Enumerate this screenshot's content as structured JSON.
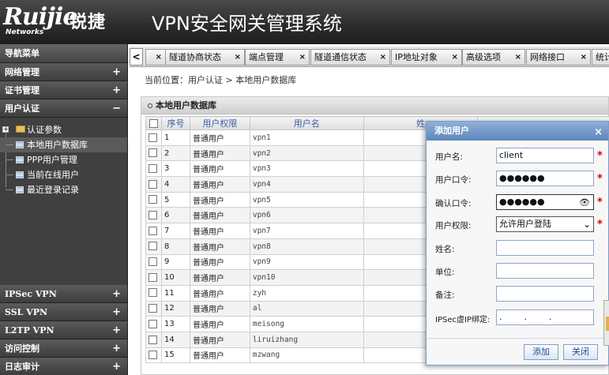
{
  "header": {
    "logo_text": "Ruijie",
    "logo_cn": "锐捷",
    "logo_sub": "Networks",
    "system_title": "VPN安全网关管理系统"
  },
  "sidebar": {
    "title": "导航菜单",
    "top_menus": [
      {
        "label": "网络管理",
        "state": "+"
      },
      {
        "label": "证书管理",
        "state": "+"
      },
      {
        "label": "用户认证",
        "state": "−"
      }
    ],
    "tree": [
      {
        "label": "认证参数"
      },
      {
        "label": "本地用户数据库"
      },
      {
        "label": "PPP用户管理"
      },
      {
        "label": "当前在线用户"
      },
      {
        "label": "最近登录记录"
      }
    ],
    "bottom_menus": [
      {
        "label": "IPSec VPN",
        "state": "+"
      },
      {
        "label": "SSL VPN",
        "state": "+"
      },
      {
        "label": "L2TP VPN",
        "state": "+"
      },
      {
        "label": "访问控制",
        "state": "+"
      },
      {
        "label": "日志审计",
        "state": "+"
      }
    ]
  },
  "tabs": {
    "prev_label": "<",
    "close_label": "×",
    "items": [
      {
        "label": ""
      },
      {
        "label": "隧道协商状态"
      },
      {
        "label": "端点管理"
      },
      {
        "label": "隧道通信状态"
      },
      {
        "label": "IP地址对象"
      },
      {
        "label": "高级选项"
      },
      {
        "label": "网络接口"
      },
      {
        "label": "统计"
      }
    ]
  },
  "breadcrumb": "当前位置：用户认证 > 本地用户数据库",
  "panel": {
    "title": "本地用户数据库",
    "columns": [
      "序号",
      "用户权限",
      "用户名",
      "姓"
    ],
    "rows": [
      {
        "no": "1",
        "perm": "普通用户",
        "name": "vpn1"
      },
      {
        "no": "2",
        "perm": "普通用户",
        "name": "vpn2"
      },
      {
        "no": "3",
        "perm": "普通用户",
        "name": "vpn3"
      },
      {
        "no": "4",
        "perm": "普通用户",
        "name": "vpn4"
      },
      {
        "no": "5",
        "perm": "普通用户",
        "name": "vpn5"
      },
      {
        "no": "6",
        "perm": "普通用户",
        "name": "vpn6"
      },
      {
        "no": "7",
        "perm": "普通用户",
        "name": "vpn7"
      },
      {
        "no": "8",
        "perm": "普通用户",
        "name": "vpn8"
      },
      {
        "no": "9",
        "perm": "普通用户",
        "name": "vpn9"
      },
      {
        "no": "10",
        "perm": "普通用户",
        "name": "vpn10"
      },
      {
        "no": "11",
        "perm": "普通用户",
        "name": "zyh"
      },
      {
        "no": "12",
        "perm": "普通用户",
        "name": "al"
      },
      {
        "no": "13",
        "perm": "普通用户",
        "name": "meisong"
      },
      {
        "no": "14",
        "perm": "普通用户",
        "name": "liruizhang"
      },
      {
        "no": "15",
        "perm": "普通用户",
        "name": "mzwang"
      }
    ]
  },
  "dialog": {
    "title": "添加用户",
    "close": "×",
    "username_label": "用户名:",
    "username_value": "client",
    "password_label": "用户口令:",
    "password_value": "●●●●●●",
    "confirm_label": "确认口令:",
    "confirm_value": "●●●●●●",
    "perm_label": "用户权限:",
    "perm_value": "允许用户登陆",
    "name_label": "姓名:",
    "unit_label": "单位:",
    "note_label": "备注:",
    "ip_label": "IPSec虚IP绑定:",
    "ip_dots": "...",
    "required_mark": "*",
    "add_button": "添加",
    "close_button": "关闭"
  }
}
